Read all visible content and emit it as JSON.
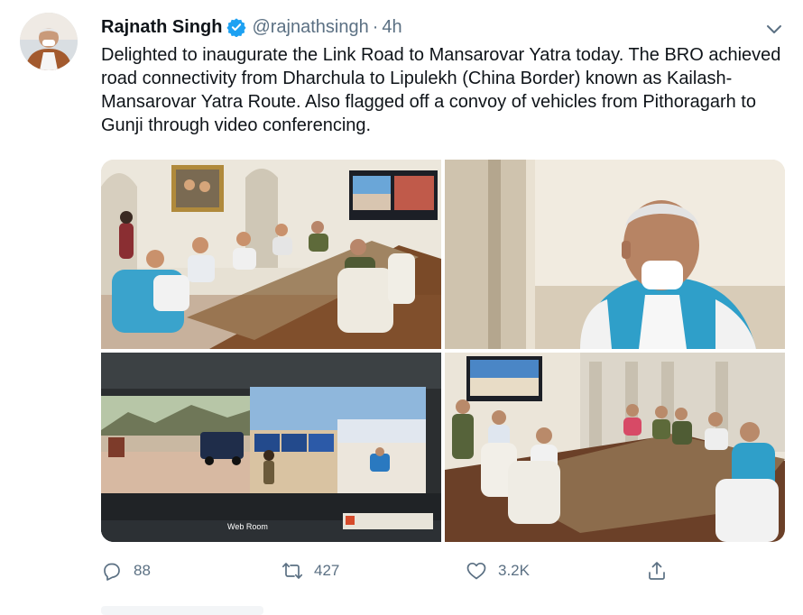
{
  "author": {
    "name": "Rajnath Singh",
    "handle": "@rajnathsingh",
    "separator": "·",
    "time": "4h",
    "verified": true
  },
  "tweet": {
    "text": "Delighted to inaugurate the Link Road  to Mansarovar Yatra today. The BRO achieved road connectivity from Dharchula to Lipulekh (China Border) known as Kailash-Mansarovar Yatra Route.  Also flagged off a convoy of vehicles from Pithoragarh to Gunji through video conferencing."
  },
  "media": {
    "photo_count": 4,
    "screen_caption": "Web Room"
  },
  "actions": {
    "reply_count": "88",
    "retweet_count": "427",
    "like_count": "3.2K"
  },
  "colors": {
    "verified_blue": "#1da1f2",
    "muted_text": "#5b7083",
    "primary_text": "#0f1419"
  },
  "icons": {
    "more": "chevron-down-icon",
    "reply": "reply-icon",
    "retweet": "retweet-icon",
    "like": "heart-icon",
    "share": "share-icon"
  }
}
